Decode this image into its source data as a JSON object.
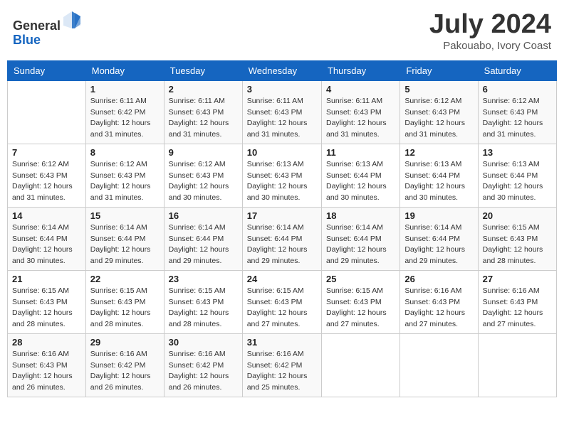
{
  "header": {
    "logo_general": "General",
    "logo_blue": "Blue",
    "month": "July 2024",
    "location": "Pakouabo, Ivory Coast"
  },
  "columns": [
    "Sunday",
    "Monday",
    "Tuesday",
    "Wednesday",
    "Thursday",
    "Friday",
    "Saturday"
  ],
  "weeks": [
    [
      {
        "day": "",
        "sunrise": "",
        "sunset": "",
        "daylight": ""
      },
      {
        "day": "1",
        "sunrise": "Sunrise: 6:11 AM",
        "sunset": "Sunset: 6:42 PM",
        "daylight": "Daylight: 12 hours and 31 minutes."
      },
      {
        "day": "2",
        "sunrise": "Sunrise: 6:11 AM",
        "sunset": "Sunset: 6:43 PM",
        "daylight": "Daylight: 12 hours and 31 minutes."
      },
      {
        "day": "3",
        "sunrise": "Sunrise: 6:11 AM",
        "sunset": "Sunset: 6:43 PM",
        "daylight": "Daylight: 12 hours and 31 minutes."
      },
      {
        "day": "4",
        "sunrise": "Sunrise: 6:11 AM",
        "sunset": "Sunset: 6:43 PM",
        "daylight": "Daylight: 12 hours and 31 minutes."
      },
      {
        "day": "5",
        "sunrise": "Sunrise: 6:12 AM",
        "sunset": "Sunset: 6:43 PM",
        "daylight": "Daylight: 12 hours and 31 minutes."
      },
      {
        "day": "6",
        "sunrise": "Sunrise: 6:12 AM",
        "sunset": "Sunset: 6:43 PM",
        "daylight": "Daylight: 12 hours and 31 minutes."
      }
    ],
    [
      {
        "day": "7",
        "sunrise": "Sunrise: 6:12 AM",
        "sunset": "Sunset: 6:43 PM",
        "daylight": "Daylight: 12 hours and 31 minutes."
      },
      {
        "day": "8",
        "sunrise": "Sunrise: 6:12 AM",
        "sunset": "Sunset: 6:43 PM",
        "daylight": "Daylight: 12 hours and 31 minutes."
      },
      {
        "day": "9",
        "sunrise": "Sunrise: 6:12 AM",
        "sunset": "Sunset: 6:43 PM",
        "daylight": "Daylight: 12 hours and 30 minutes."
      },
      {
        "day": "10",
        "sunrise": "Sunrise: 6:13 AM",
        "sunset": "Sunset: 6:43 PM",
        "daylight": "Daylight: 12 hours and 30 minutes."
      },
      {
        "day": "11",
        "sunrise": "Sunrise: 6:13 AM",
        "sunset": "Sunset: 6:44 PM",
        "daylight": "Daylight: 12 hours and 30 minutes."
      },
      {
        "day": "12",
        "sunrise": "Sunrise: 6:13 AM",
        "sunset": "Sunset: 6:44 PM",
        "daylight": "Daylight: 12 hours and 30 minutes."
      },
      {
        "day": "13",
        "sunrise": "Sunrise: 6:13 AM",
        "sunset": "Sunset: 6:44 PM",
        "daylight": "Daylight: 12 hours and 30 minutes."
      }
    ],
    [
      {
        "day": "14",
        "sunrise": "Sunrise: 6:14 AM",
        "sunset": "Sunset: 6:44 PM",
        "daylight": "Daylight: 12 hours and 30 minutes."
      },
      {
        "day": "15",
        "sunrise": "Sunrise: 6:14 AM",
        "sunset": "Sunset: 6:44 PM",
        "daylight": "Daylight: 12 hours and 29 minutes."
      },
      {
        "day": "16",
        "sunrise": "Sunrise: 6:14 AM",
        "sunset": "Sunset: 6:44 PM",
        "daylight": "Daylight: 12 hours and 29 minutes."
      },
      {
        "day": "17",
        "sunrise": "Sunrise: 6:14 AM",
        "sunset": "Sunset: 6:44 PM",
        "daylight": "Daylight: 12 hours and 29 minutes."
      },
      {
        "day": "18",
        "sunrise": "Sunrise: 6:14 AM",
        "sunset": "Sunset: 6:44 PM",
        "daylight": "Daylight: 12 hours and 29 minutes."
      },
      {
        "day": "19",
        "sunrise": "Sunrise: 6:14 AM",
        "sunset": "Sunset: 6:44 PM",
        "daylight": "Daylight: 12 hours and 29 minutes."
      },
      {
        "day": "20",
        "sunrise": "Sunrise: 6:15 AM",
        "sunset": "Sunset: 6:43 PM",
        "daylight": "Daylight: 12 hours and 28 minutes."
      }
    ],
    [
      {
        "day": "21",
        "sunrise": "Sunrise: 6:15 AM",
        "sunset": "Sunset: 6:43 PM",
        "daylight": "Daylight: 12 hours and 28 minutes."
      },
      {
        "day": "22",
        "sunrise": "Sunrise: 6:15 AM",
        "sunset": "Sunset: 6:43 PM",
        "daylight": "Daylight: 12 hours and 28 minutes."
      },
      {
        "day": "23",
        "sunrise": "Sunrise: 6:15 AM",
        "sunset": "Sunset: 6:43 PM",
        "daylight": "Daylight: 12 hours and 28 minutes."
      },
      {
        "day": "24",
        "sunrise": "Sunrise: 6:15 AM",
        "sunset": "Sunset: 6:43 PM",
        "daylight": "Daylight: 12 hours and 27 minutes."
      },
      {
        "day": "25",
        "sunrise": "Sunrise: 6:15 AM",
        "sunset": "Sunset: 6:43 PM",
        "daylight": "Daylight: 12 hours and 27 minutes."
      },
      {
        "day": "26",
        "sunrise": "Sunrise: 6:16 AM",
        "sunset": "Sunset: 6:43 PM",
        "daylight": "Daylight: 12 hours and 27 minutes."
      },
      {
        "day": "27",
        "sunrise": "Sunrise: 6:16 AM",
        "sunset": "Sunset: 6:43 PM",
        "daylight": "Daylight: 12 hours and 27 minutes."
      }
    ],
    [
      {
        "day": "28",
        "sunrise": "Sunrise: 6:16 AM",
        "sunset": "Sunset: 6:43 PM",
        "daylight": "Daylight: 12 hours and 26 minutes."
      },
      {
        "day": "29",
        "sunrise": "Sunrise: 6:16 AM",
        "sunset": "Sunset: 6:42 PM",
        "daylight": "Daylight: 12 hours and 26 minutes."
      },
      {
        "day": "30",
        "sunrise": "Sunrise: 6:16 AM",
        "sunset": "Sunset: 6:42 PM",
        "daylight": "Daylight: 12 hours and 26 minutes."
      },
      {
        "day": "31",
        "sunrise": "Sunrise: 6:16 AM",
        "sunset": "Sunset: 6:42 PM",
        "daylight": "Daylight: 12 hours and 25 minutes."
      },
      {
        "day": "",
        "sunrise": "",
        "sunset": "",
        "daylight": ""
      },
      {
        "day": "",
        "sunrise": "",
        "sunset": "",
        "daylight": ""
      },
      {
        "day": "",
        "sunrise": "",
        "sunset": "",
        "daylight": ""
      }
    ]
  ]
}
